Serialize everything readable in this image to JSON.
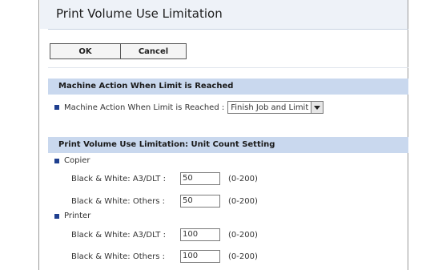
{
  "page": {
    "title": "Print Volume Use Limitation"
  },
  "buttons": {
    "ok": "OK",
    "cancel": "Cancel"
  },
  "machine_action": {
    "header": "Machine Action When Limit is Reached",
    "label": "Machine Action When Limit is Reached :",
    "selected": "Finish Job and Limit"
  },
  "unit_count": {
    "header": "Print Volume Use Limitation: Unit Count Setting",
    "copier": {
      "label": "Copier",
      "a3_label": "Black & White: A3/DLT :",
      "a3_value": "50",
      "others_label": "Black & White: Others :",
      "others_value": "50"
    },
    "printer": {
      "label": "Printer",
      "a3_label": "Black & White: A3/DLT :",
      "a3_value": "100",
      "others_label": "Black & White: Others :",
      "others_value": "100"
    },
    "range": "(0-200)"
  },
  "colors": {
    "section_header": "#c9d8ee",
    "bullet": "#1f3f8f",
    "title_bg": "#eef2f8"
  }
}
